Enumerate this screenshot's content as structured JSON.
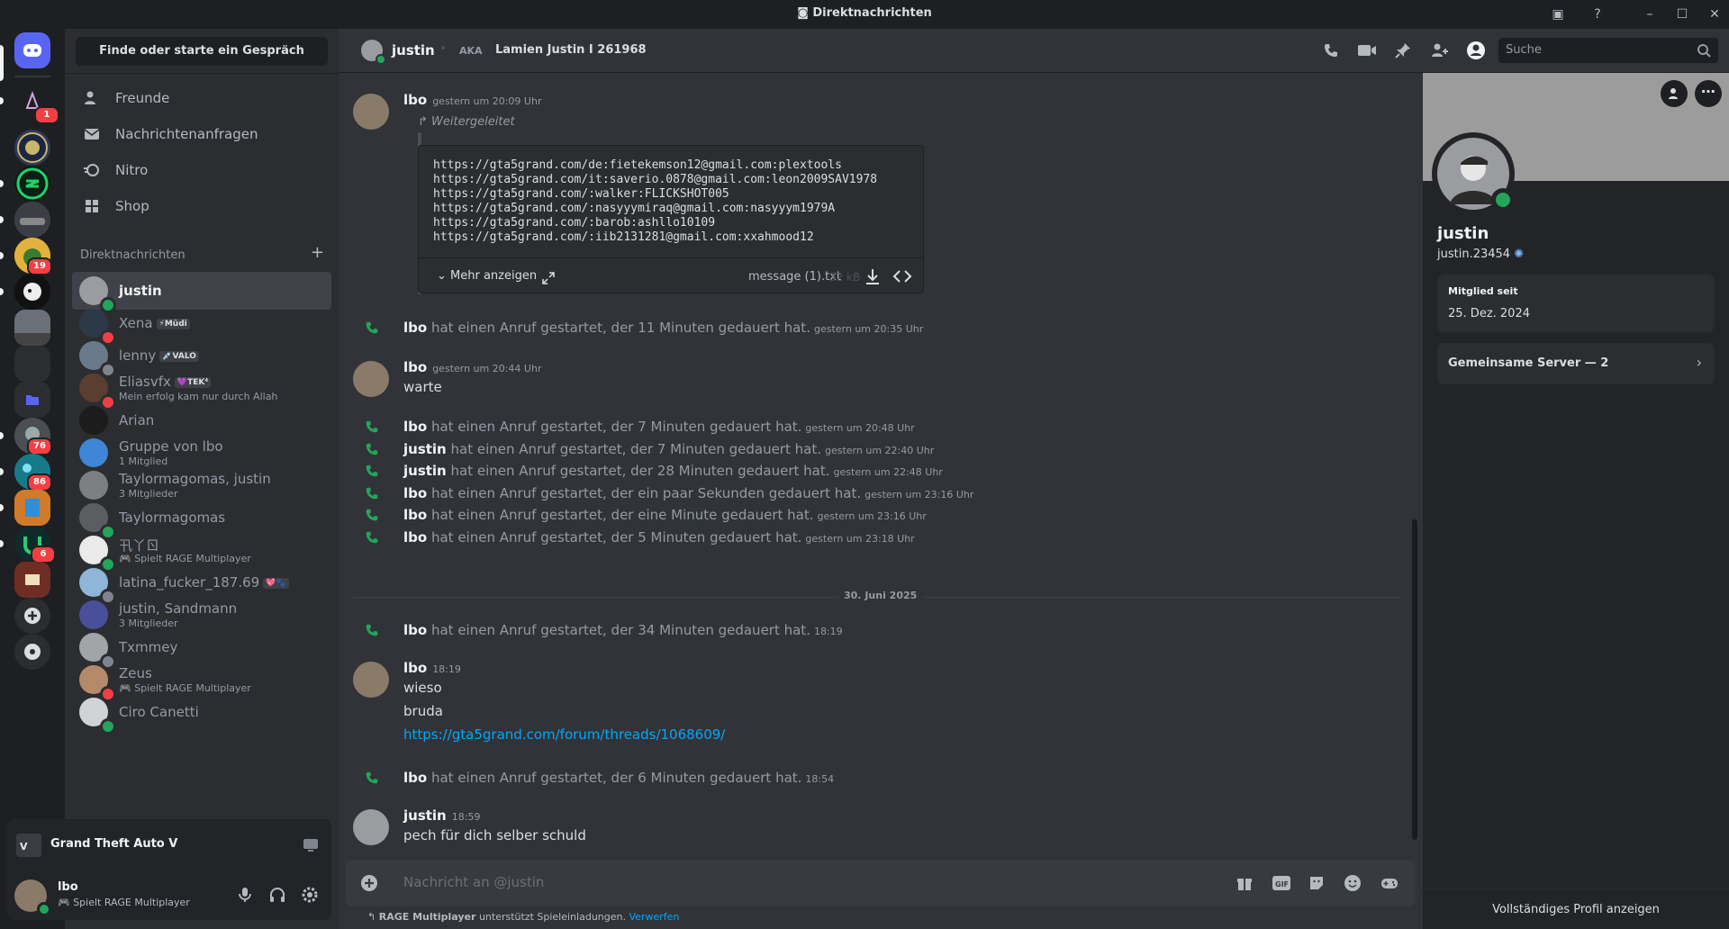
{
  "window": {
    "title": "Direktnachrichten"
  },
  "sidebar": {
    "find_placeholder": "Finde oder starte ein Gespräch",
    "nav": [
      {
        "label": "Freunde",
        "icon": "friends-icon"
      },
      {
        "label": "Nachrichtenanfragen",
        "icon": "mail-icon"
      },
      {
        "label": "Nitro",
        "icon": "nitro-icon"
      },
      {
        "label": "Shop",
        "icon": "shop-icon"
      }
    ],
    "dm_header": "Direktnachrichten",
    "dms": [
      {
        "name": "justin",
        "sub": "",
        "status": "online",
        "active": true
      },
      {
        "name": "Xena",
        "tag": "⚡Müdi",
        "sub": "",
        "status": "dnd"
      },
      {
        "name": "lenny",
        "tag": "💉VALO",
        "sub": "",
        "status": "offline"
      },
      {
        "name": "Eliasvfx",
        "tag": "💜TEK⁴",
        "sub": "Mein erfolg kam nur durch Allah",
        "status": "dnd"
      },
      {
        "name": "Arian",
        "sub": "",
        "status": "none"
      },
      {
        "name": "Gruppe von lbo",
        "sub": "1 Mitglied",
        "status": "none"
      },
      {
        "name": "Taylormagomas, justin",
        "sub": "3 Mitglieder",
        "status": "none"
      },
      {
        "name": "Taylormagomas",
        "sub": "",
        "status": "online"
      },
      {
        "name": "卂丫ㄖ",
        "sub": "🎮 Spielt RAGE Multiplayer",
        "status": "online"
      },
      {
        "name": "latina_fucker_187.69",
        "tag": "💖🐾",
        "sub": "",
        "status": "offline"
      },
      {
        "name": "justin, Sandmann",
        "sub": "3 Mitglieder",
        "status": "none"
      },
      {
        "name": "Txmmey",
        "sub": "",
        "status": "offline"
      },
      {
        "name": "Zeus",
        "sub": "🎮 Spielt RAGE Multiplayer",
        "status": "dnd"
      },
      {
        "name": "Ciro Canetti",
        "sub": "",
        "status": "online"
      }
    ]
  },
  "game_panel": {
    "title": "Grand Theft Auto V"
  },
  "user_panel": {
    "name": "lbo",
    "activity": "Spielt RAGE Multiplayer"
  },
  "chat_header": {
    "name": "justin",
    "aka_label": "AKA",
    "aka": "Lamien Justin I 261968",
    "search_placeholder": "Suche"
  },
  "messages": {
    "m1": {
      "author": "lbo",
      "time": "gestern um 20:09 Uhr",
      "forwarded": "Weitergeleitet",
      "code": "https://gta5grand.com/de:fietekemson12@gmail.com:plextools\nhttps://gta5grand.com/it:saverio.0878@gmail.com:leon2009SAV1978\nhttps://gta5grand.com/:walker:FLICKSHOT005\nhttps://gta5grand.com/:nasyyymiraq@gmail.com:nasyyym1979A\nhttps://gta5grand.com/:barob:ashllo10109\nhttps://gta5grand.com/:iib2131281@gmail.com:xxahmood12",
      "more": "Mehr anzeigen",
      "filename": "message (1).txt",
      "filesize": "32 kB"
    },
    "call1": {
      "who": "lbo",
      "text": "hat einen Anruf gestartet, der 11 Minuten gedauert hat.",
      "time": "gestern um 20:35 Uhr"
    },
    "m2": {
      "author": "lbo",
      "time": "gestern um 20:44 Uhr",
      "text": "warte"
    },
    "calls": [
      {
        "who": "lbo",
        "text": "hat einen Anruf gestartet, der 7 Minuten gedauert hat.",
        "time": "gestern um 20:48 Uhr"
      },
      {
        "who": "justin",
        "text": "hat einen Anruf gestartet, der 7 Minuten gedauert hat.",
        "time": "gestern um 22:40 Uhr"
      },
      {
        "who": "justin",
        "text": "hat einen Anruf gestartet, der 28 Minuten gedauert hat.",
        "time": "gestern um 22:48 Uhr"
      },
      {
        "who": "lbo",
        "text": "hat einen Anruf gestartet, der ein paar Sekunden gedauert hat.",
        "time": "gestern um 23:16 Uhr"
      },
      {
        "who": "lbo",
        "text": "hat einen Anruf gestartet, der eine Minute gedauert hat.",
        "time": "gestern um 23:16 Uhr"
      },
      {
        "who": "lbo",
        "text": "hat einen Anruf gestartet, der 5 Minuten gedauert hat.",
        "time": "gestern um 23:18 Uhr"
      }
    ],
    "date_divider": "30. Juni 2025",
    "call2": {
      "who": "lbo",
      "text": "hat einen Anruf gestartet, der 34 Minuten gedauert hat.",
      "time": "18:19"
    },
    "m3": {
      "author": "lbo",
      "time": "18:19",
      "line1": "wieso",
      "line2": "bruda",
      "link": "https://gta5grand.com/forum/threads/1068609/"
    },
    "call3": {
      "who": "lbo",
      "text": "hat einen Anruf gestartet, der 6 Minuten gedauert hat.",
      "time": "18:54"
    },
    "m4": {
      "author": "justin",
      "time": "18:59",
      "text": "pech für dich selber schuld"
    }
  },
  "composer": {
    "placeholder": "Nachricht an @justin",
    "hint_bold": "RAGE Multiplayer",
    "hint": "unterstützt Spieleinladungen.",
    "hint_link": "Verwerfen"
  },
  "profile": {
    "name": "justin",
    "username": "justin.23454",
    "member_label": "Mitglied seit",
    "member_since": "25. Dez. 2024",
    "servers_label": "Gemeinsame Server — 2",
    "full_profile": "Vollständiges Profil anzeigen"
  },
  "colors": {
    "accent": "#5865f2",
    "online": "#23a55a",
    "dnd": "#f23f43",
    "offline": "#80848e",
    "link": "#00a8fc",
    "phone": "#23a55a"
  }
}
